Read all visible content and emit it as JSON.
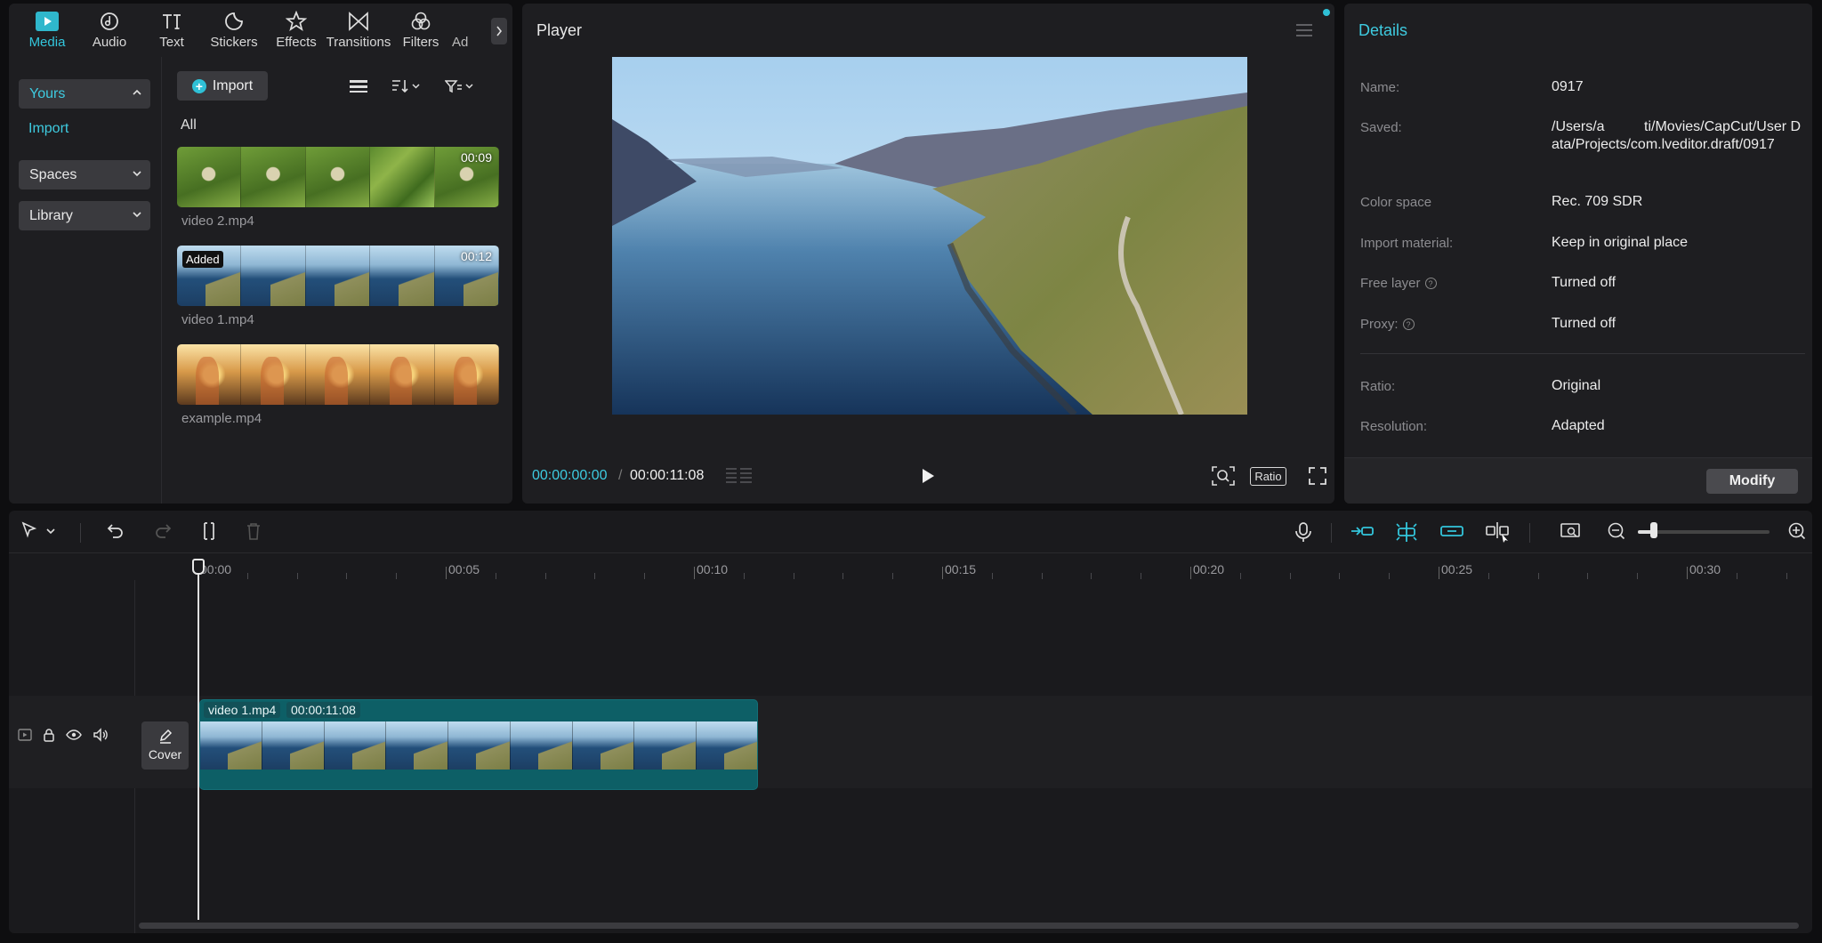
{
  "media": {
    "tabs": [
      {
        "label": "Media",
        "icon": "media-icon"
      },
      {
        "label": "Audio",
        "icon": "audio-icon"
      },
      {
        "label": "Text",
        "icon": "text-icon"
      },
      {
        "label": "Stickers",
        "icon": "sticker-icon"
      },
      {
        "label": "Effects",
        "icon": "effects-icon"
      },
      {
        "label": "Transitions",
        "icon": "transitions-icon"
      },
      {
        "label": "Filters",
        "icon": "filters-icon"
      },
      {
        "label": "Ad",
        "icon": "adjust-icon"
      }
    ],
    "sidebar": {
      "yours": "Yours",
      "import_link": "Import",
      "spaces": "Spaces",
      "library": "Library"
    },
    "import_button": "Import",
    "filter_all": "All",
    "clips": [
      {
        "name": "video 2.mp4",
        "duration": "00:09"
      },
      {
        "name": "video 1.mp4",
        "duration": "00:12",
        "badge": "Added"
      },
      {
        "name": "example.mp4",
        "duration": ""
      }
    ]
  },
  "player": {
    "title": "Player",
    "current_time": "00:00:00:00",
    "separator": "/",
    "total_time": "00:00:11:08",
    "ratio_label": "Ratio"
  },
  "details": {
    "title": "Details",
    "rows": [
      {
        "label": "Name:",
        "value": "0917"
      },
      {
        "label": "Saved:",
        "value": "/Users/a          ti/Movies/CapCut/User Data/Projects/com.lveditor.draft/0917"
      },
      {
        "label": "Color space",
        "value": "Rec. 709 SDR"
      },
      {
        "label": "Import material:",
        "value": "Keep in original place"
      },
      {
        "label": "Free layer",
        "value": "Turned off"
      },
      {
        "label": "Proxy:",
        "value": "Turned off"
      },
      {
        "label": "Ratio:",
        "value": "Original"
      },
      {
        "label": "Resolution:",
        "value": "Adapted"
      }
    ],
    "modify_button": "Modify"
  },
  "timeline": {
    "ruler": [
      "00:00",
      "00:05",
      "00:10",
      "00:15",
      "00:20",
      "00:25",
      "00:30"
    ],
    "cover_label": "Cover",
    "clip_name": "video 1.mp4",
    "clip_duration": "00:00:11:08",
    "zoom_level": 0.12
  },
  "colors": {
    "accent": "#33c6dc",
    "clip_track": "#0d5f66",
    "panel": "#1e1e21"
  }
}
